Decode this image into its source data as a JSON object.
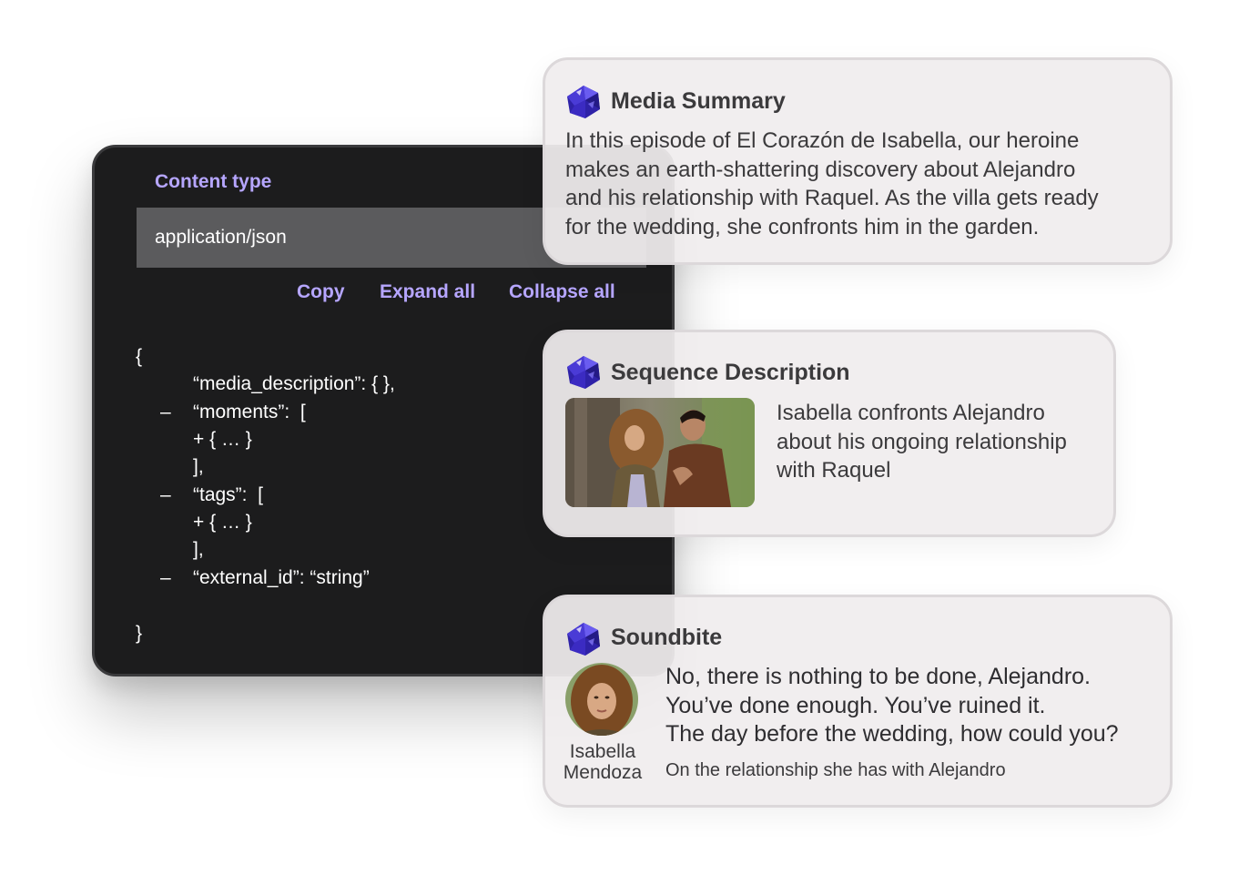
{
  "code_panel": {
    "content_type_label": "Content type",
    "content_type_value": "application/json",
    "actions": {
      "copy": "Copy",
      "expand_all": "Expand all",
      "collapse_all": "Collapse all"
    },
    "lines": [
      "{",
      "“media_description”: { },",
      "“moments”:  [",
      "+ { … }",
      "],",
      "“tags”:  [",
      "+ { … }",
      "],",
      "“external_id”: “string”",
      "}"
    ],
    "collapse_marker": "–"
  },
  "media_summary": {
    "title": "Media Summary",
    "icon": "gem-icon",
    "lines": [
      "In this episode of El Corazón de Isabella, our heroine",
      "makes an earth-shattering discovery about Alejandro",
      "and his relationship with Raquel. As the villa gets ready",
      "for the wedding, she confronts him in the garden."
    ]
  },
  "sequence_description": {
    "title": "Sequence Description",
    "icon": "gem-icon",
    "lines": [
      "Isabella confronts Alejandro",
      "about his ongoing relationship",
      "with Raquel"
    ]
  },
  "soundbite": {
    "title": "Soundbite",
    "icon": "gem-icon",
    "speaker_first": "Isabella",
    "speaker_last": "Mendoza",
    "quote_lines": [
      "No, there is nothing to be done, Alejandro.",
      "You’ve done enough. You’ve ruined it.",
      "The day before the wedding, how could you?"
    ],
    "context": "On the relationship she has with Alejandro"
  },
  "colors": {
    "accent": "#b6a6ff",
    "panel_bg": "#1c1c1d",
    "card_bg": "#f0edee",
    "gem": "#3b2bb8"
  }
}
